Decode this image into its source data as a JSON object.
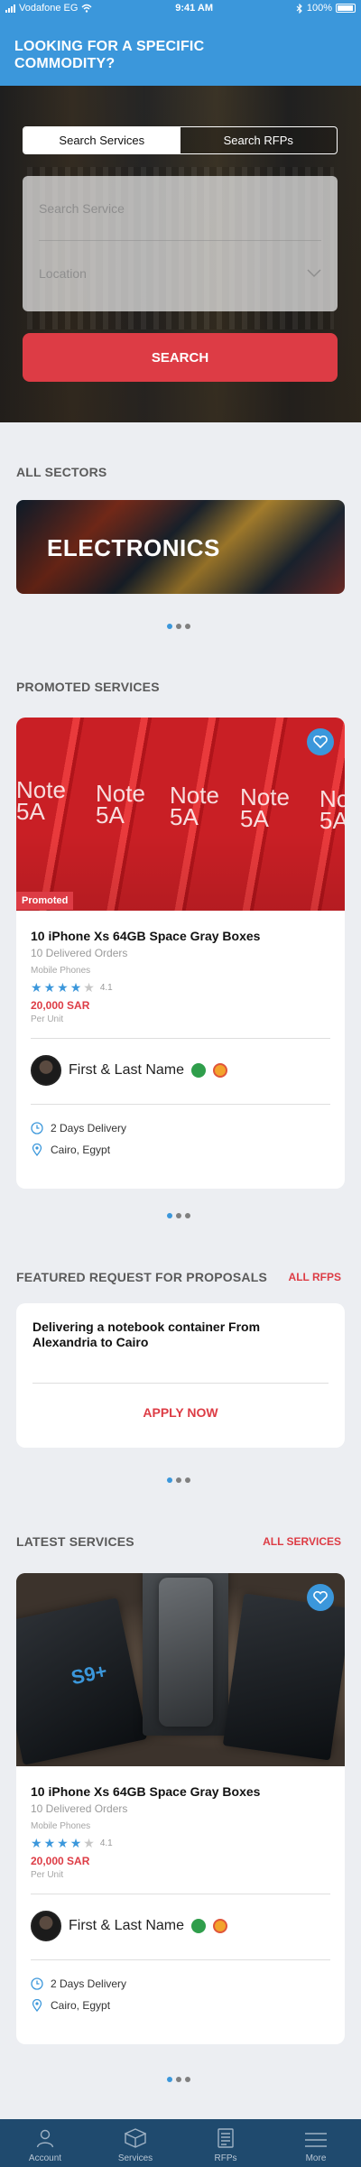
{
  "status_bar": {
    "carrier": "Vodafone EG",
    "time": "9:41 AM",
    "battery": "100%"
  },
  "header": {
    "title_line1": "LOOKING FOR A SPECIFIC",
    "title_line2": "COMMODITY?"
  },
  "search": {
    "tabs": [
      {
        "label": "Search Services",
        "active": true
      },
      {
        "label": "Search RFPs",
        "active": false
      }
    ],
    "service_placeholder": "Search Service",
    "location_placeholder": "Location",
    "button_label": "SEARCH"
  },
  "sectors": {
    "title": "ALL SECTORS",
    "banner_label": "ELECTRONICS"
  },
  "promoted": {
    "title": "PROMOTED SERVICES",
    "card": {
      "badge": "Promoted",
      "image_text": [
        "Note",
        "5A"
      ],
      "title": "10 iPhone Xs 64GB Space Gray Boxes",
      "orders": "10 Delivered Orders",
      "category": "Mobile Phones",
      "rating": 4.1,
      "rating_text": "4.1",
      "price": "20,000 SAR",
      "unit": "Per Unit",
      "seller": "First & Last Name",
      "delivery": "2 Days Delivery",
      "location": "Cairo, Egypt"
    }
  },
  "rfps": {
    "title": "FEATURED REQUEST FOR PROPOSALS",
    "link": "ALL RFPS",
    "card": {
      "title": "Delivering a notebook container From Alexandria to Cairo",
      "action": "APPLY NOW"
    }
  },
  "latest": {
    "title": "LATEST SERVICES",
    "link": "ALL SERVICES",
    "card": {
      "image_text": "S9+",
      "title": "10 iPhone Xs 64GB Space Gray Boxes",
      "orders": "10 Delivered Orders",
      "category": "Mobile Phones",
      "rating": 4.1,
      "rating_text": "4.1",
      "price": "20,000 SAR",
      "unit": "Per Unit",
      "seller": "First & Last Name",
      "delivery": "2 Days Delivery",
      "location": "Cairo, Egypt"
    }
  },
  "tabbar": {
    "items": [
      {
        "label": "Account",
        "icon": "user-icon"
      },
      {
        "label": "Services",
        "icon": "box-icon"
      },
      {
        "label": "RFPs",
        "icon": "document-icon"
      },
      {
        "label": "More",
        "icon": "menu-icon"
      }
    ]
  },
  "colors": {
    "primary_blue": "#3b97db",
    "accent_red": "#dd3c45",
    "tabbar_navy": "#1f4a6e"
  }
}
